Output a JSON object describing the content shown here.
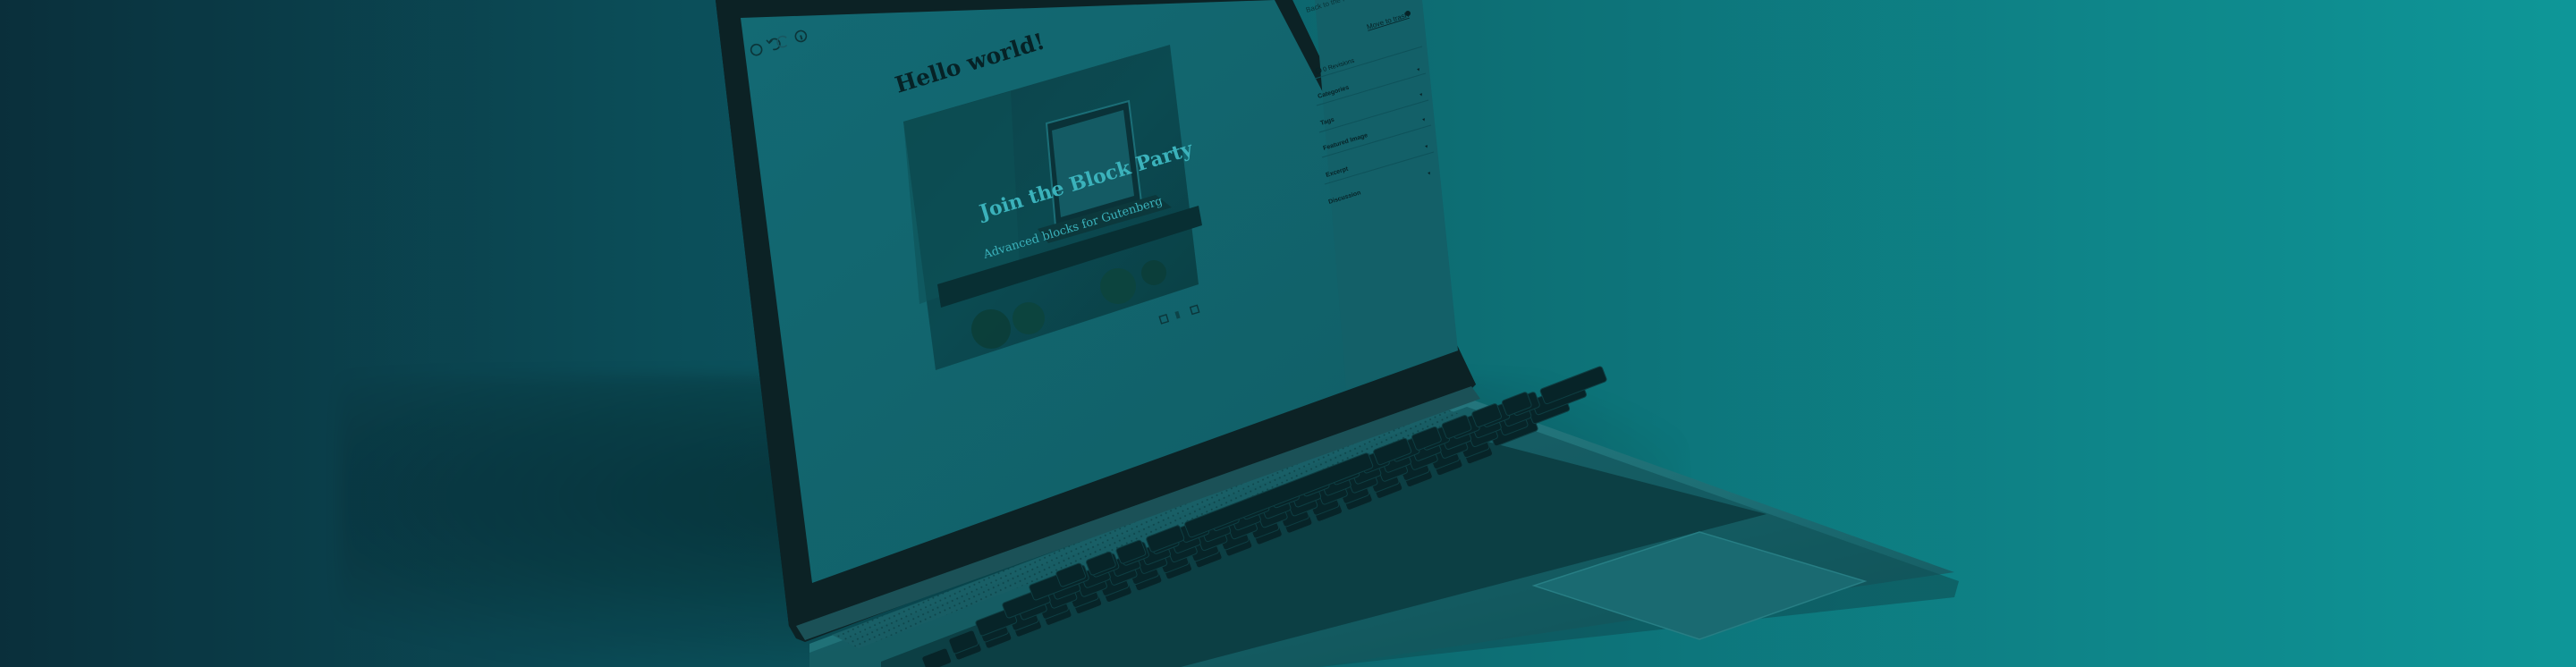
{
  "editor": {
    "post_title": "Hello world!",
    "toolbar_icons": [
      "settings-icon",
      "undo-icon",
      "redo-icon",
      "info-icon"
    ]
  },
  "cover_block": {
    "heading": "Join the Block Party",
    "subheading": "Advanced blocks for Gutenberg"
  },
  "sidebar": {
    "top_link": "Move to trash",
    "header_text": "Back to the Post",
    "panels": [
      {
        "label": "0 Revisions"
      },
      {
        "label": "Categories"
      },
      {
        "label": "Tags"
      },
      {
        "label": "Featured Image"
      },
      {
        "label": "Excerpt"
      },
      {
        "label": "Discussion"
      }
    ]
  },
  "colors": {
    "bg_left": "#0a2a37",
    "bg_right": "#0f9a9c",
    "screen_tint": "#13666f",
    "cover_text": "#3fb8c2"
  }
}
